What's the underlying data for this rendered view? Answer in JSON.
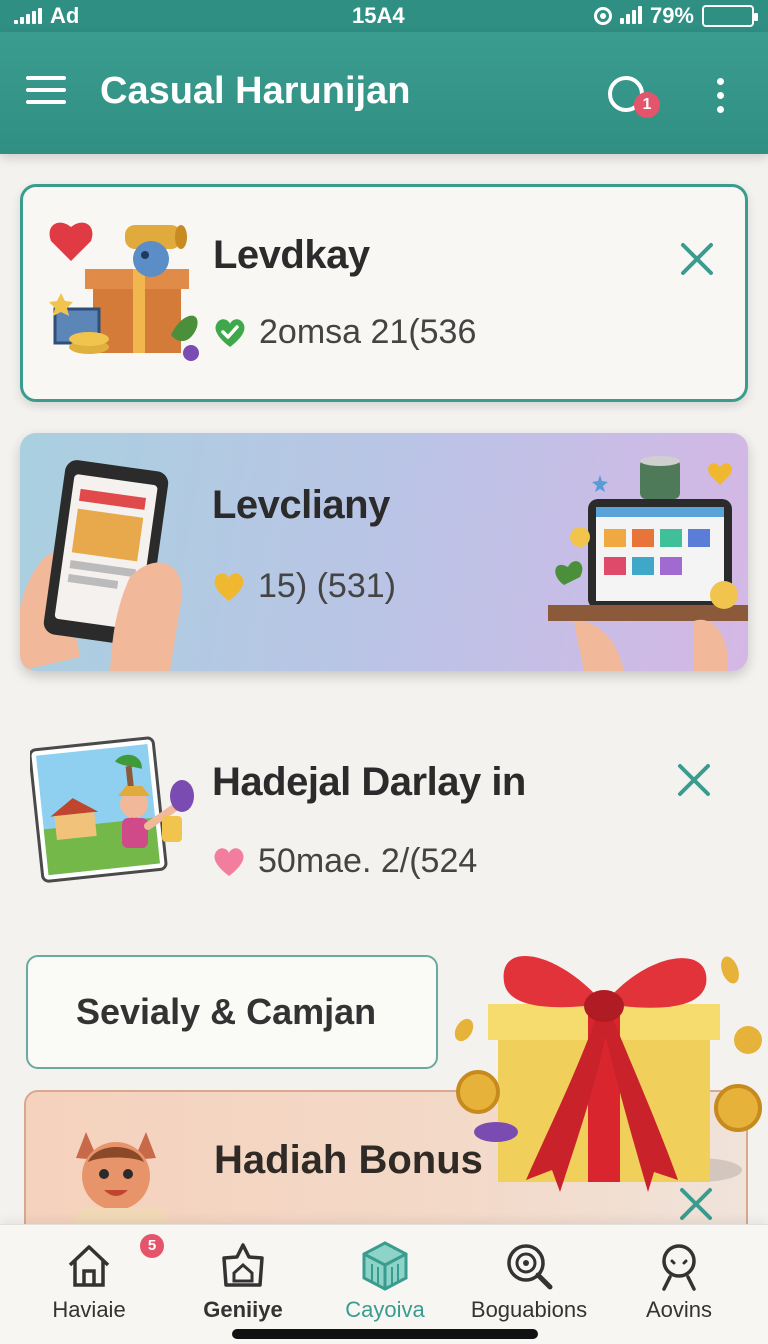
{
  "status_bar": {
    "carrier": "Ad",
    "time": "15A4",
    "battery": "79%",
    "battery_level": 0.79
  },
  "app_bar": {
    "title": "Casual Harunijan",
    "chat_badge": "1"
  },
  "cards": [
    {
      "title": "Levdkay",
      "meta": "2omsa 21(536",
      "meta_icon": "green-heart-check-icon"
    },
    {
      "title": "Levcliany",
      "meta": "15) (531)",
      "meta_icon": "gold-heart-icon"
    },
    {
      "title": "Hadejal Darlay in",
      "meta": "50mae. 2/(524",
      "meta_icon": "pink-heart-icon"
    }
  ],
  "category_button": {
    "label": "Sevialy & Camjan"
  },
  "bonus": {
    "title": "Hadiah Bonus"
  },
  "bottom_nav": {
    "items": [
      {
        "label": "Haviaie",
        "icon": "home-icon",
        "badge": "5"
      },
      {
        "label": "Geniiye",
        "icon": "star-house-icon"
      },
      {
        "label": "Cayoiva",
        "icon": "cube-icon",
        "active": true
      },
      {
        "label": "Boguabions",
        "icon": "target-search-icon"
      },
      {
        "label": "Aovins",
        "icon": "profile-icon"
      }
    ]
  },
  "colors": {
    "primary": "#3a9c8e",
    "badge": "#e4546a",
    "close": "#3a9c8e"
  }
}
